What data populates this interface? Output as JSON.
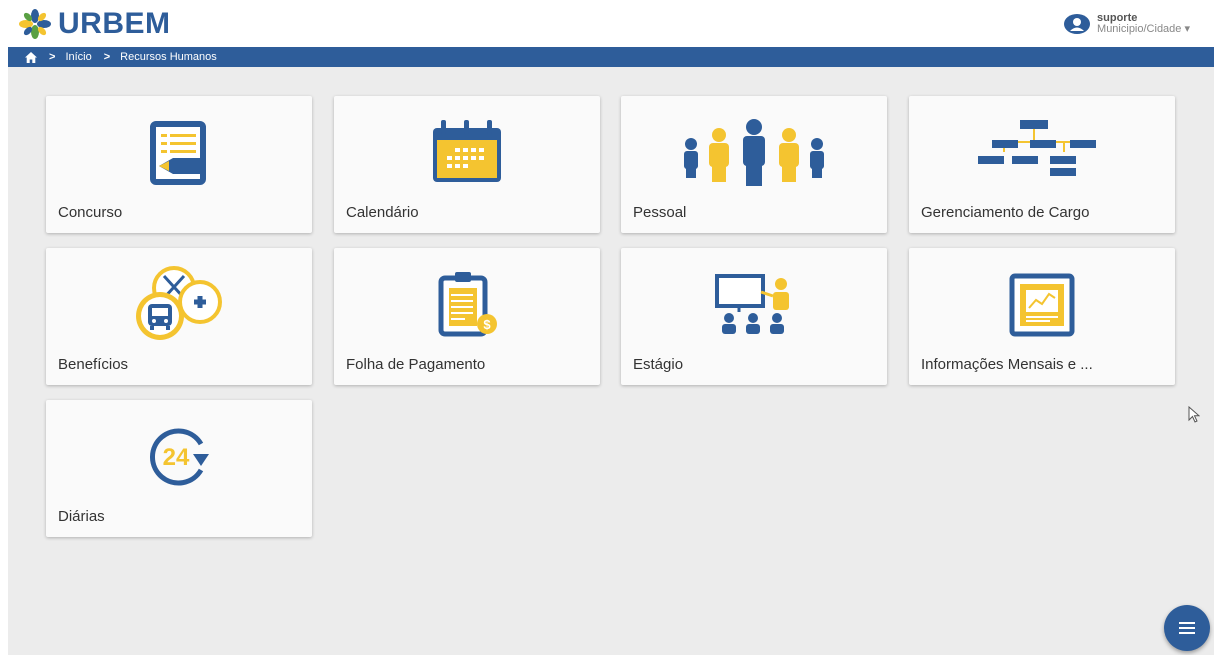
{
  "header": {
    "logo_text": "URBEM",
    "user": {
      "name": "suporte",
      "location": "Municipio/Cidade"
    }
  },
  "breadcrumb": {
    "items": [
      "Início",
      "Recursos Humanos"
    ]
  },
  "tiles": [
    {
      "label": "Concurso",
      "icon": "exam-document-icon"
    },
    {
      "label": "Calendário",
      "icon": "calendar-icon"
    },
    {
      "label": "Pessoal",
      "icon": "people-group-icon"
    },
    {
      "label": "Gerenciamento de Cargo",
      "icon": "org-chart-icon"
    },
    {
      "label": "Benefícios",
      "icon": "benefits-icon"
    },
    {
      "label": "Folha de Pagamento",
      "icon": "payroll-clipboard-icon"
    },
    {
      "label": "Estágio",
      "icon": "internship-presentation-icon"
    },
    {
      "label": "Informações Mensais e ...",
      "icon": "monthly-report-icon"
    },
    {
      "label": "Diárias",
      "icon": "24h-icon"
    }
  ],
  "colors": {
    "brand_blue": "#2e5d9a",
    "accent_yellow": "#f4c430",
    "background": "#ececec"
  }
}
